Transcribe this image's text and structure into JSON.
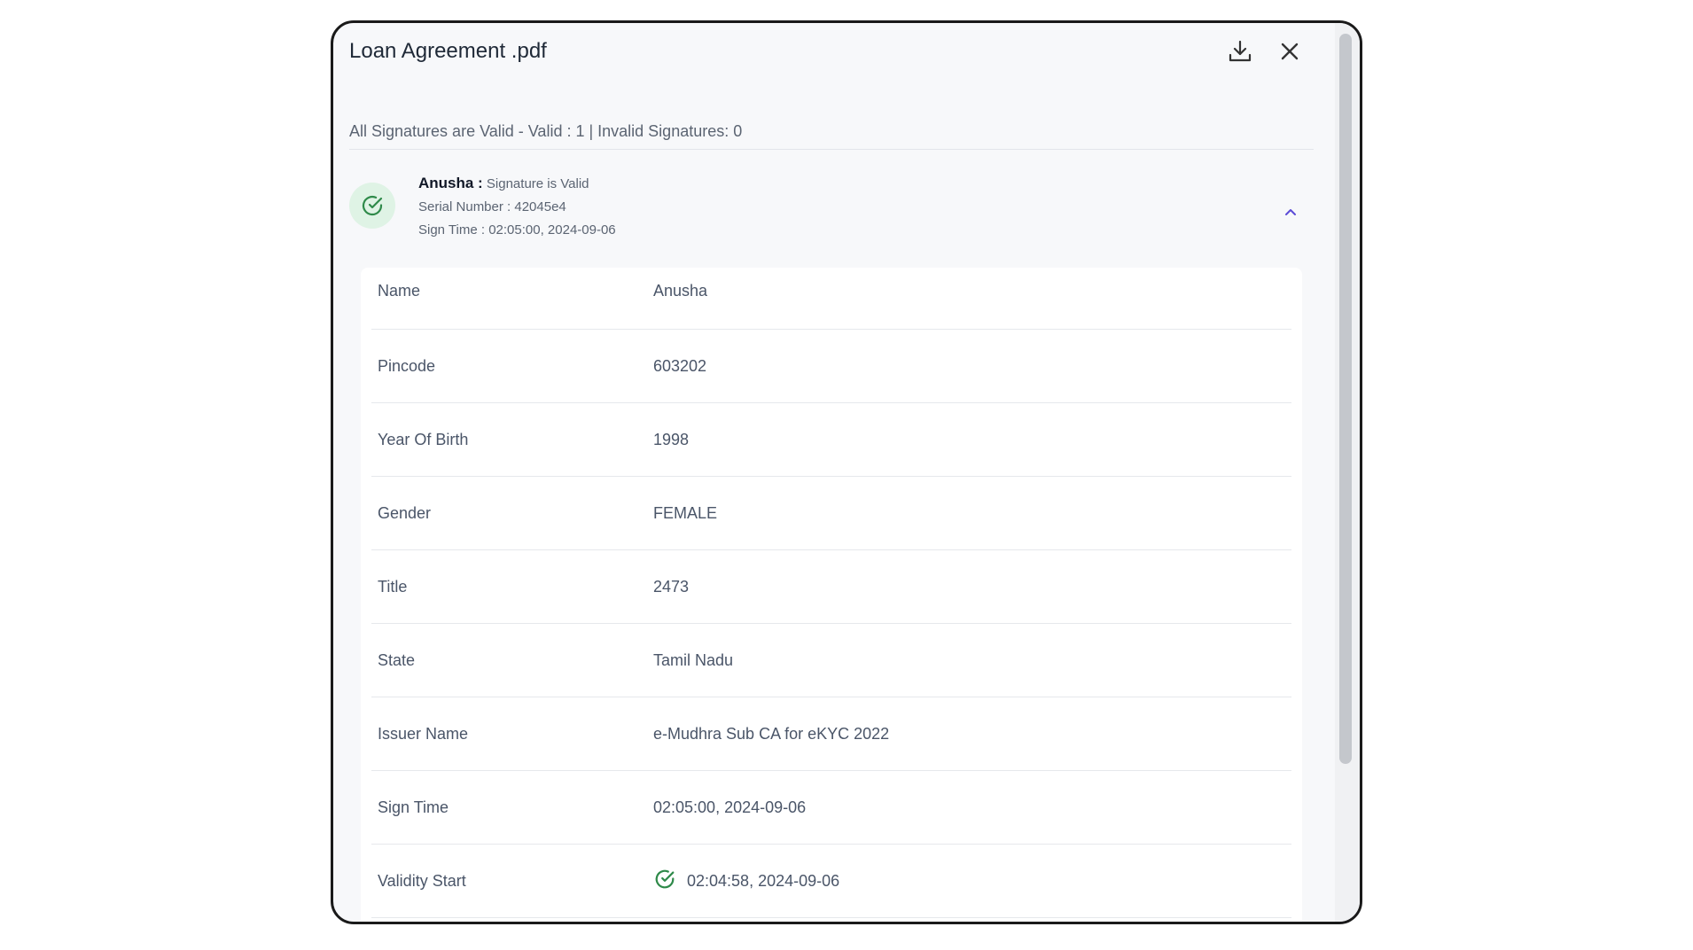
{
  "modal": {
    "title": "Loan Agreement .pdf",
    "summary": "All Signatures are Valid - Valid : 1 | Invalid Signatures: 0"
  },
  "signer": {
    "name": "Anusha :",
    "status": "Signature is Valid",
    "serial": "Serial Number : 42045e4",
    "sign_time": "Sign Time : 02:05:00, 2024-09-06"
  },
  "details": [
    {
      "label": "Name",
      "value": "Anusha"
    },
    {
      "label": "Pincode",
      "value": "603202"
    },
    {
      "label": "Year Of Birth",
      "value": "1998"
    },
    {
      "label": "Gender",
      "value": "FEMALE"
    },
    {
      "label": "Title",
      "value": "2473"
    },
    {
      "label": "State",
      "value": "Tamil Nadu"
    },
    {
      "label": "Issuer Name",
      "value": "e-Mudhra Sub CA for eKYC 2022"
    },
    {
      "label": "Sign Time",
      "value": "02:05:00, 2024-09-06"
    },
    {
      "label": "Validity Start",
      "value": "02:04:58, 2024-09-06"
    }
  ],
  "icons": {
    "download": "download-icon",
    "close": "close-icon",
    "signer_status": "check-circle-icon",
    "expand": "chevron-up-icon",
    "validity": "check-circle-icon"
  },
  "colors": {
    "valid_green": "#2f8a4a",
    "badge_bg": "#dff3e5",
    "chevron": "#5b4bd6"
  }
}
